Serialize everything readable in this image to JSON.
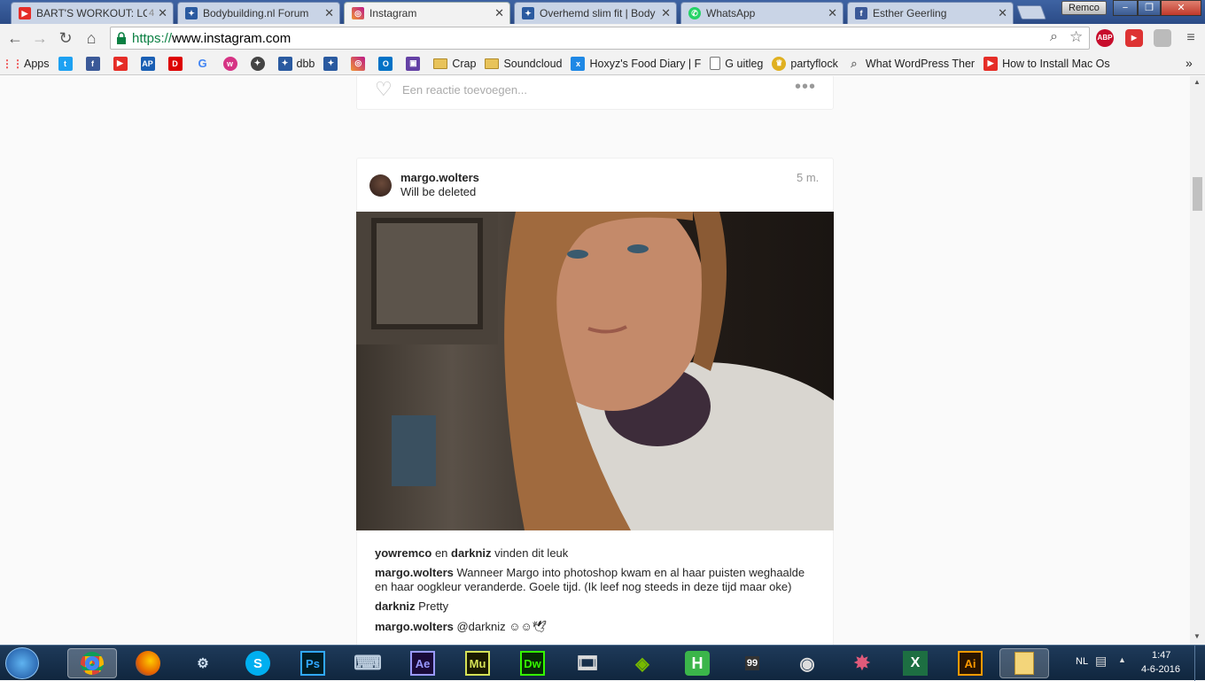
{
  "tabs": [
    {
      "title": "BART'S WORKOUT: LO",
      "count": "4",
      "favicon": "youtube-icon",
      "color": "#e52d27"
    },
    {
      "title": "Bodybuilding.nl Forum",
      "favicon": "bodybuilding-icon",
      "color": "#2a5aa0"
    },
    {
      "title": "Instagram",
      "favicon": "instagram-icon",
      "color": "#c13584",
      "active": true
    },
    {
      "title": "Overhemd slim fit | Body",
      "favicon": "bodybuilding-icon",
      "color": "#2a5aa0"
    },
    {
      "title": "WhatsApp",
      "favicon": "whatsapp-icon",
      "color": "#25d366"
    },
    {
      "title": "Esther Geerling",
      "favicon": "facebook-icon",
      "color": "#3b5998"
    }
  ],
  "profile_name": "Remco",
  "window": {
    "minimize": "−",
    "restore": "❐",
    "close": "✕"
  },
  "address": {
    "scheme": "https://",
    "host": "www.instagram.com"
  },
  "extensions": {
    "abp": "ABP"
  },
  "bookmarks": [
    {
      "label": "Apps",
      "icon": "apps-grid-icon"
    },
    {
      "label": "",
      "icon": "twitter-icon"
    },
    {
      "label": "",
      "icon": "facebook-icon"
    },
    {
      "label": "",
      "icon": "youtube-icon"
    },
    {
      "label": "",
      "icon": "ap-icon"
    },
    {
      "label": "",
      "icon": "dumpert-icon"
    },
    {
      "label": "",
      "icon": "google-icon"
    },
    {
      "label": "",
      "icon": "pink-circle-icon"
    },
    {
      "label": "",
      "icon": "bodybuilding-icon"
    },
    {
      "label": "dbb",
      "icon": "bodybuilding-icon"
    },
    {
      "label": "",
      "icon": "bodybuilding-icon"
    },
    {
      "label": "",
      "icon": "instagram-icon"
    },
    {
      "label": "",
      "icon": "outlook-icon"
    },
    {
      "label": "",
      "icon": "twitch-icon"
    },
    {
      "label": "Crap",
      "icon": "folder-icon"
    },
    {
      "label": "Soundcloud",
      "icon": "folder-icon"
    },
    {
      "label": "Hoxyz's Food Diary | F",
      "icon": "food-diary-icon"
    },
    {
      "label": "G uitleg",
      "icon": "page-icon"
    },
    {
      "label": "partyflock",
      "icon": "partyflock-icon"
    },
    {
      "label": "What WordPress Ther",
      "icon": "search-page-icon"
    },
    {
      "label": "How to Install Mac Os",
      "icon": "youtube-icon"
    }
  ],
  "prev_post": {
    "comment_placeholder": "Een reactie toevoegen..."
  },
  "post": {
    "username": "margo.wolters",
    "location": "Will be deleted",
    "time": "5 m.",
    "likes": {
      "user1": "yowremco",
      "joiner": "en",
      "user2": "darkniz",
      "suffix": "vinden dit leuk"
    },
    "comments": [
      {
        "user": "margo.wolters",
        "text": "Wanneer Margo into photoshop kwam en al haar puisten weghaalde en haar oogkleur veranderde. Goele tijd. (Ik leef nog steeds in deze tijd maar oke)"
      },
      {
        "user": "darkniz",
        "text": "Pretty"
      },
      {
        "user": "margo.wolters",
        "text": "@darkniz ☺☺🕊"
      }
    ]
  },
  "taskbar": {
    "apps": [
      {
        "name": "chrome",
        "label": ""
      },
      {
        "name": "firefox",
        "label": ""
      },
      {
        "name": "steam",
        "label": ""
      },
      {
        "name": "skype",
        "label": "S"
      },
      {
        "name": "photoshop",
        "label": "Ps"
      },
      {
        "name": "keyboard",
        "label": ""
      },
      {
        "name": "after-effects",
        "label": "Ae"
      },
      {
        "name": "muse",
        "label": "Mu"
      },
      {
        "name": "dreamweaver",
        "label": "Dw"
      },
      {
        "name": "video-editor",
        "label": ""
      },
      {
        "name": "nvidia",
        "label": ""
      },
      {
        "name": "handbrake",
        "label": "H"
      },
      {
        "name": "99",
        "label": "99"
      },
      {
        "name": "racing",
        "label": ""
      },
      {
        "name": "game",
        "label": ""
      },
      {
        "name": "excel",
        "label": "X"
      },
      {
        "name": "illustrator",
        "label": "Ai"
      },
      {
        "name": "explorer",
        "label": ""
      }
    ],
    "language": "NL",
    "time": "1:47",
    "date": "4-6-2016"
  }
}
